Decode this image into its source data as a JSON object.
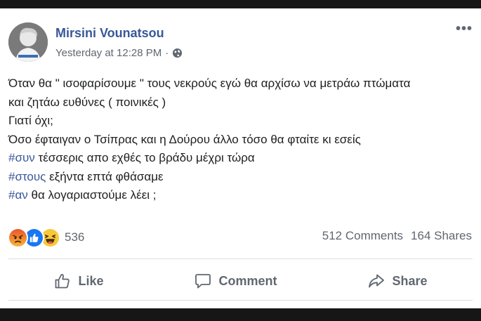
{
  "post": {
    "author": "Mirsini Vounatsou",
    "timestamp": "Yesterday at 12:28 PM",
    "separator": "·",
    "audience_icon": "globe-icon",
    "more_label": "•••",
    "lines": [
      {
        "hashtag": "",
        "text": "Όταν θα \" ισοφαρίσουμε \" τους νεκρούς εγώ θα αρχίσω να μετράω πτώματα"
      },
      {
        "hashtag": "",
        "text": "και ζητάω ευθύνες ( ποινικές )"
      },
      {
        "hashtag": "",
        "text": "Γιατί όχι;"
      },
      {
        "hashtag": "",
        "text": "Όσο έφταιγαν ο Τσίπρας και η Δούρου άλλο τόσο θα φταίτε κι εσείς"
      },
      {
        "hashtag": "#συν",
        "text": " τέσσερις απο εχθές το βράδυ μέχρι τώρα"
      },
      {
        "hashtag": "#στους",
        "text": " εξήντα επτά φθάσαμε"
      },
      {
        "hashtag": "#αν",
        "text": " θα λογαριαστούμε λέει ;"
      }
    ]
  },
  "reactions": {
    "icons": [
      "angry-reaction-icon",
      "like-reaction-icon",
      "haha-reaction-icon"
    ],
    "count": "536"
  },
  "stats": {
    "comments": "512 Comments",
    "shares": "164 Shares"
  },
  "actions": {
    "like": "Like",
    "comment": "Comment",
    "share": "Share"
  },
  "colors": {
    "author": "#385898",
    "hashtag": "#385898",
    "muted": "#606770",
    "text": "#1c1e21"
  }
}
